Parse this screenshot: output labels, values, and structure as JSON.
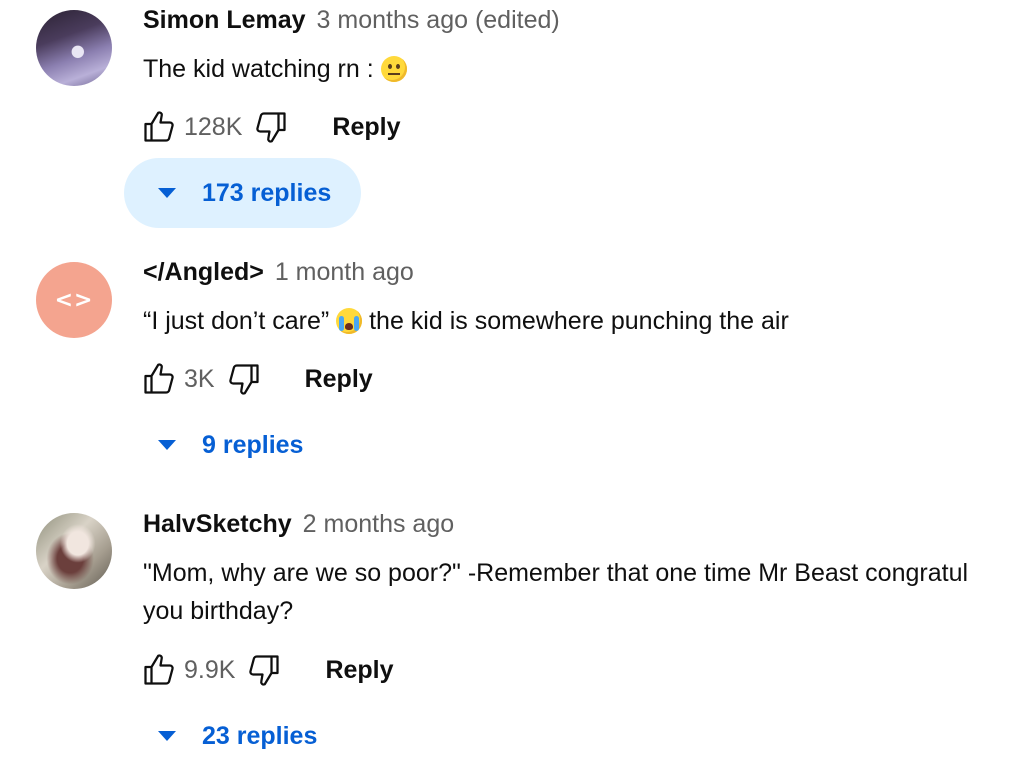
{
  "comments": [
    {
      "author": "Simon Lemay",
      "meta": "3 months ago (edited)",
      "text_before": "The kid watching rn :",
      "text_after": "",
      "emoji": "neutral-face",
      "likes": "128K",
      "reply_label": "Reply",
      "replies_label": "173 replies",
      "replies_active": true
    },
    {
      "author": "</Angled>",
      "avatar_text": "<>",
      "meta": "1 month ago",
      "text_before": "“I just don’t care”",
      "text_after": "the kid is somewhere punching the air",
      "emoji": "loudly-crying-face",
      "likes": "3K",
      "reply_label": "Reply",
      "replies_label": "9 replies",
      "replies_active": false
    },
    {
      "author": "HalvSketchy",
      "meta": "2 months ago",
      "text_line1": "\"Mom, why are we so poor?\" -Remember that one time Mr Beast congratul",
      "text_line2": "you birthday?",
      "likes": "9.9K",
      "reply_label": "Reply",
      "replies_label": "23 replies",
      "replies_active": false
    }
  ],
  "icons": {
    "like": "thumbs-up-icon",
    "dislike": "thumbs-down-icon",
    "expand": "caret-down-icon"
  },
  "colors": {
    "link_blue": "#065fd4",
    "active_pill_bg": "#def1ff",
    "meta_gray": "#606060",
    "avatar_angled": "#f4a48f"
  }
}
